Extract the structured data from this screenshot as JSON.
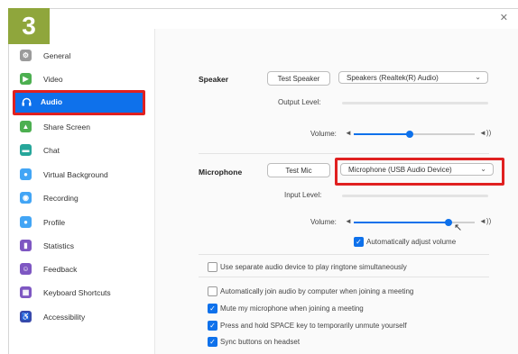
{
  "step_badge": "3",
  "sidebar": {
    "items": [
      {
        "label": "General",
        "icon": "gear-icon",
        "color": "#9b9b9b"
      },
      {
        "label": "Video",
        "icon": "video-camera-icon",
        "color": "#4caf50"
      },
      {
        "label": "Audio",
        "icon": "headphones-icon",
        "color": "#0e71eb",
        "active": true
      },
      {
        "label": "Share Screen",
        "icon": "share-screen-icon",
        "color": "#4caf50"
      },
      {
        "label": "Chat",
        "icon": "chat-bubble-icon",
        "color": "#26a69a"
      },
      {
        "label": "Virtual Background",
        "icon": "person-background-icon",
        "color": "#42a5f5"
      },
      {
        "label": "Recording",
        "icon": "record-icon",
        "color": "#42a5f5"
      },
      {
        "label": "Profile",
        "icon": "profile-icon",
        "color": "#42a5f5"
      },
      {
        "label": "Statistics",
        "icon": "bar-chart-icon",
        "color": "#7e57c2"
      },
      {
        "label": "Feedback",
        "icon": "smiley-icon",
        "color": "#7e57c2"
      },
      {
        "label": "Keyboard Shortcuts",
        "icon": "keyboard-icon",
        "color": "#7e57c2"
      },
      {
        "label": "Accessibility",
        "icon": "accessibility-icon",
        "color": "#3949ab"
      }
    ]
  },
  "speaker": {
    "label": "Speaker",
    "test_button": "Test Speaker",
    "device": "Speakers (Realtek(R) Audio)",
    "output_level_label": "Output Level:",
    "volume_label": "Volume:",
    "volume_level": 0.46
  },
  "microphone": {
    "label": "Microphone",
    "test_button": "Test Mic",
    "device": "Microphone (USB Audio Device)",
    "input_level_label": "Input Level:",
    "volume_label": "Volume:",
    "volume_level": 0.78,
    "auto_adjust_label": "Automatically adjust volume",
    "auto_adjust": true
  },
  "options": [
    {
      "label": "Use separate audio device to play ringtone simultaneously",
      "checked": false
    },
    {
      "label": "Automatically join audio by computer when joining a meeting",
      "checked": false
    },
    {
      "label": "Mute my microphone when joining a meeting",
      "checked": true
    },
    {
      "label": "Press and hold SPACE key to temporarily unmute yourself",
      "checked": true
    },
    {
      "label": "Sync buttons on headset",
      "checked": true
    }
  ],
  "colors": {
    "accent": "#0e71eb",
    "highlight": "#e02020",
    "badge": "#8fa63c"
  }
}
